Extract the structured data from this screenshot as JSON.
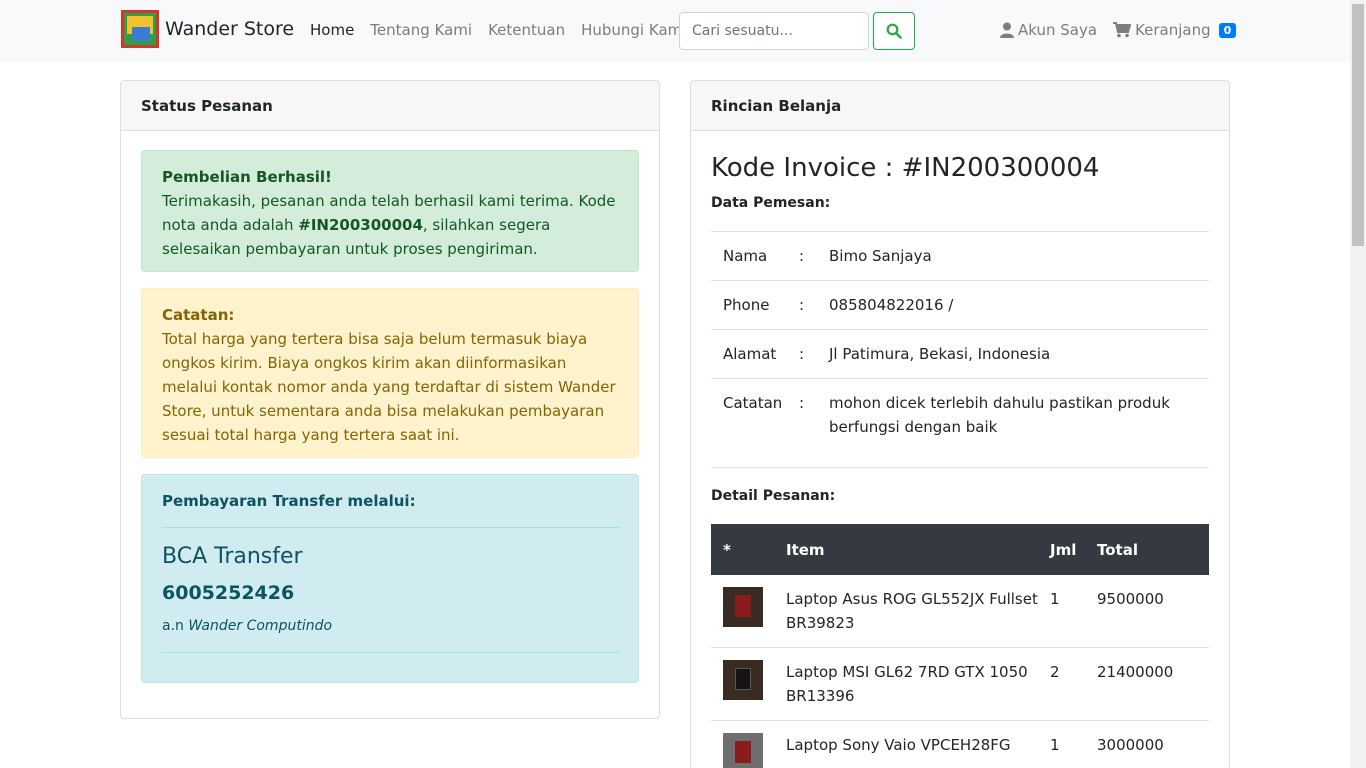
{
  "brand": {
    "name": "Wander Store"
  },
  "nav": {
    "items": [
      {
        "label": "Home",
        "active": true
      },
      {
        "label": "Tentang Kami",
        "active": false
      },
      {
        "label": "Ketentuan",
        "active": false
      },
      {
        "label": "Hubungi Kami",
        "active": false
      }
    ],
    "search_placeholder": "Cari sesuatu...",
    "account_label": "Akun Saya",
    "cart_label": "Keranjang",
    "cart_count": "0"
  },
  "status": {
    "header": "Status Pesanan",
    "success_title": "Pembelian Berhasil!",
    "success_text_1": "Terimakasih, pesanan anda telah berhasil kami terima. Kode nota anda adalah ",
    "success_code": "#IN200300004",
    "success_text_2": ", silahkan segera selesaikan pembayaran untuk proses pengiriman.",
    "note_title": "Catatan:",
    "note_text": "Total harga yang tertera bisa saja belum termasuk biaya ongkos kirim. Biaya ongkos kirim akan diinformasikan melalui kontak nomor anda yang terdaftar di sistem Wander Store, untuk sementara anda bisa melakukan pembayaran sesuai total harga yang tertera saat ini.",
    "payment_title": "Pembayaran Transfer melalui:",
    "bank_name": "BCA Transfer",
    "account_number": "6005252426",
    "owner_prefix": "a.n ",
    "owner_name": "Wander Computindo"
  },
  "invoice": {
    "header": "Rincian Belanja",
    "title": "Kode Invoice : #IN200300004",
    "customer_label": "Data Pemesan:",
    "customer": [
      {
        "key": "Nama",
        "sep": ":",
        "value": "Bimo Sanjaya"
      },
      {
        "key": "Phone",
        "sep": ":",
        "value": "085804822016 /"
      },
      {
        "key": "Alamat",
        "sep": ":",
        "value": "Jl Patimura, Bekasi, Indonesia"
      },
      {
        "key": "Catatan",
        "sep": ":",
        "value": "mohon dicek terlebih dahulu pastikan produk berfungsi dengan baik"
      }
    ],
    "order_label": "Detail Pesanan:",
    "columns": [
      "*",
      "Item",
      "Jml",
      "Total"
    ],
    "rows": [
      {
        "item": "Laptop Asus ROG GL552JX Fullset",
        "code": "BR39823",
        "qty": "1",
        "total": "9500000"
      },
      {
        "item": "Laptop MSI GL62 7RD GTX 1050",
        "code": "BR13396",
        "qty": "2",
        "total": "21400000"
      },
      {
        "item": "Laptop Sony Vaio VPCEH28FG",
        "code": "",
        "qty": "1",
        "total": "3000000"
      }
    ]
  },
  "colors": {
    "success": "#d4edda",
    "warning": "#fff3cd",
    "info": "#d1ecf1",
    "accent": "#007bff",
    "search_btn": "#28a745",
    "table_head": "#343a40"
  }
}
